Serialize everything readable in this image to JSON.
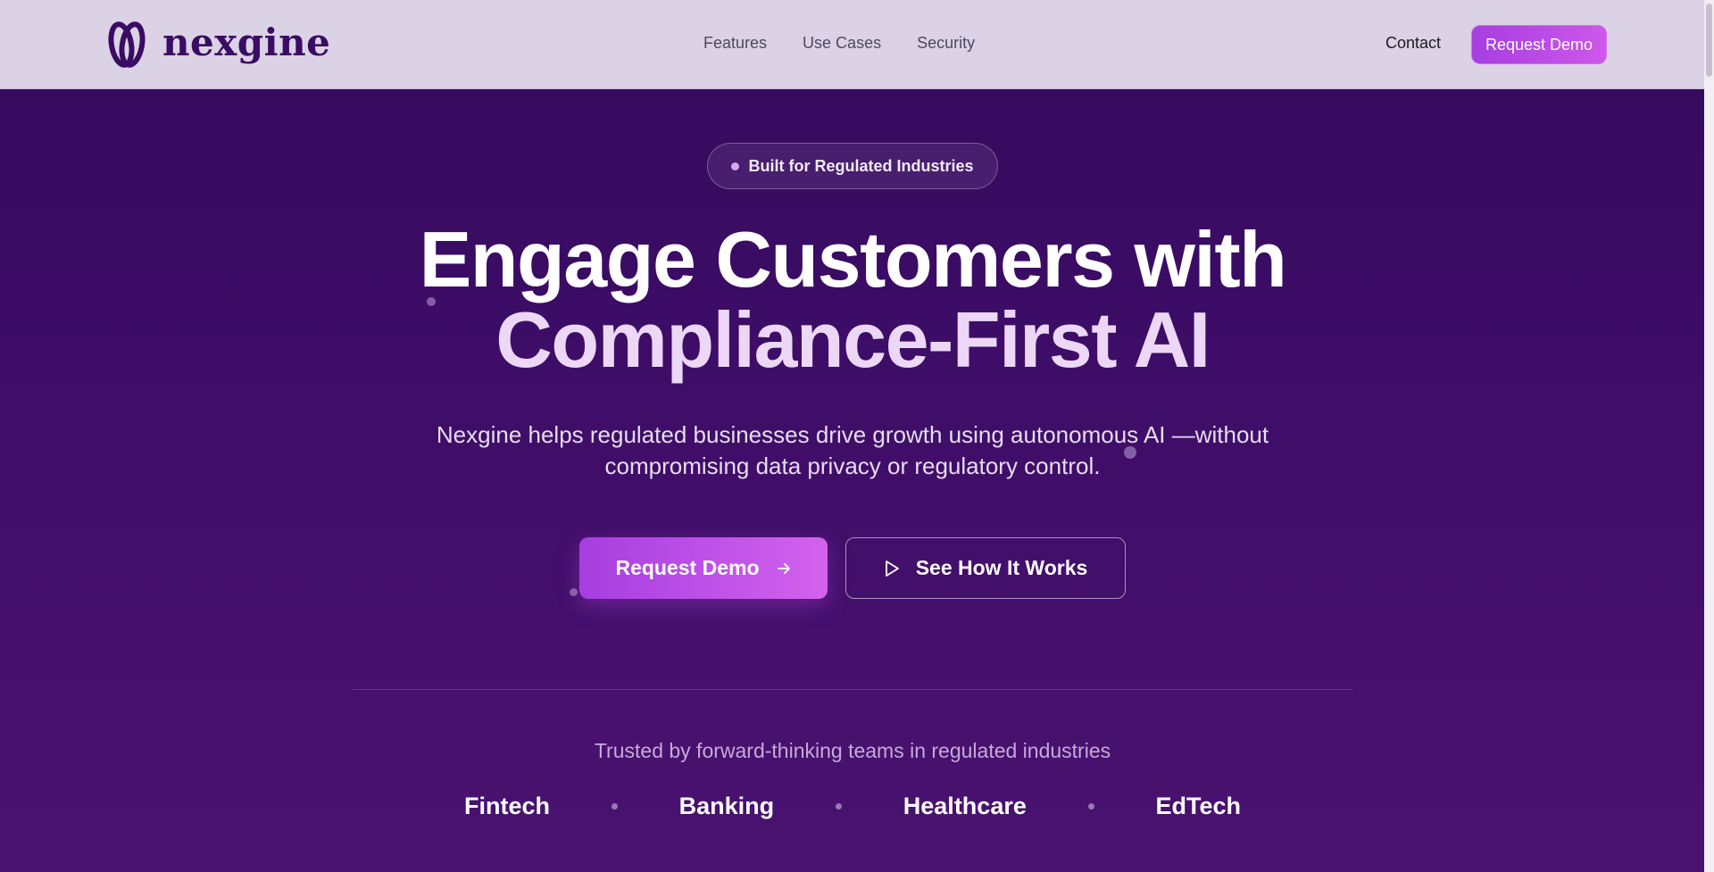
{
  "brand": {
    "name": "nexgine",
    "logo_icon": "nexgine-logo-mark"
  },
  "nav": {
    "items": [
      {
        "label": "Features"
      },
      {
        "label": "Use Cases"
      },
      {
        "label": "Security"
      }
    ],
    "contact_label": "Contact",
    "cta_label": "Request Demo"
  },
  "hero": {
    "badge": "Built for Regulated Industries",
    "headline_line1": "Engage Customers with",
    "headline_line2": "Compliance-First AI",
    "subtitle": "Nexgine helps regulated businesses drive growth using autonomous AI —without compromising data privacy or regulatory control.",
    "primary_cta": {
      "label": "Request Demo",
      "icon": "arrow-right-icon"
    },
    "secondary_cta": {
      "label": "See How It Works",
      "icon": "play-icon"
    }
  },
  "trusted": {
    "heading": "Trusted by forward-thinking teams in regulated industries",
    "industries": [
      "Fintech",
      "Banking",
      "Healthcare",
      "EdTech"
    ]
  },
  "colors": {
    "header_bg": "#dcd2e5",
    "hero_bg": "#3d0d67",
    "accent": "#b84be6",
    "brand_text": "#3a0c63"
  }
}
